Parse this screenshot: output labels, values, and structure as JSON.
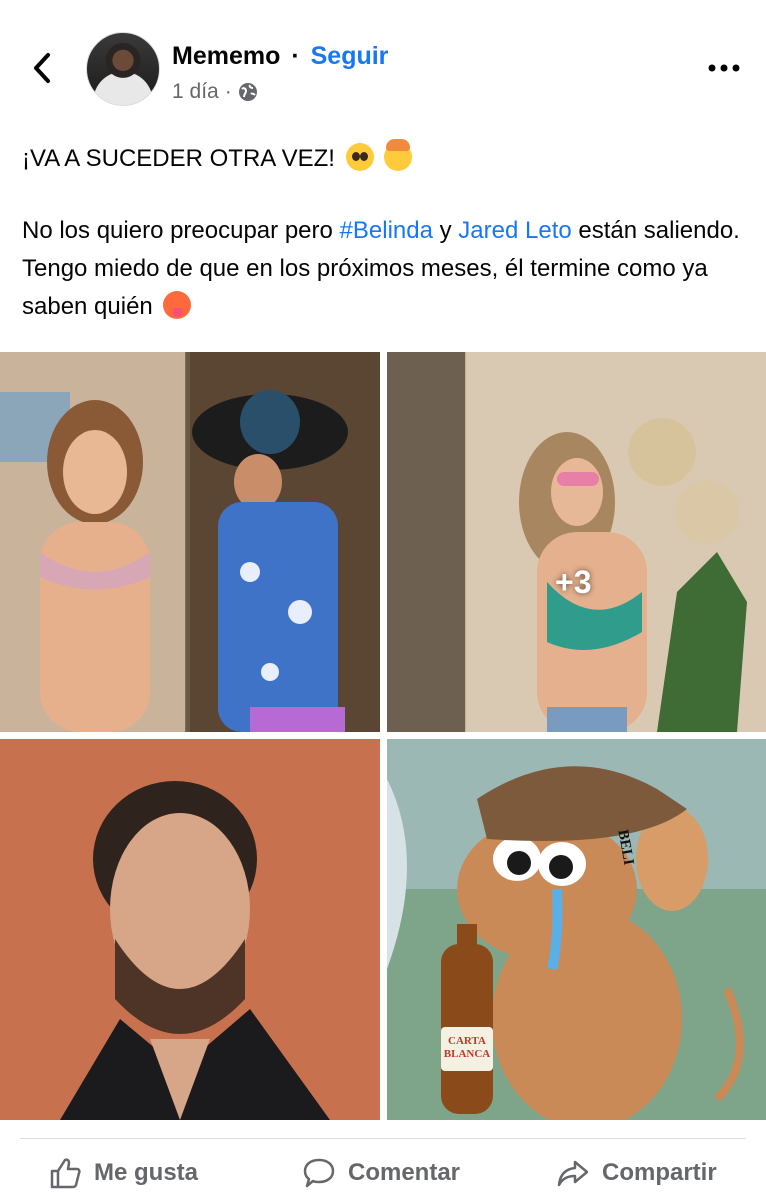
{
  "header": {
    "author": "Mememo",
    "separator": "·",
    "follow_label": "Seguir",
    "time_label": "1 día",
    "time_separator": "·",
    "privacy_icon": "globe-icon",
    "back_icon": "chevron-left-icon",
    "more_icon": "more-horizontal-icon"
  },
  "post": {
    "headline": "¡VA A SUCEDER OTRA VEZ!",
    "body_1": "No los quiero preocupar pero",
    "hashtag": "#Belinda",
    "body_2": "y",
    "mention": "Jared Leto",
    "body_3": "están saliendo. Tengo miedo de que en los próximos meses, él termine como ya saben quién"
  },
  "photos": {
    "more_count": "+3",
    "beer_label": "CARTA BLANCA",
    "hat_text": "BELI"
  },
  "actions": {
    "like_label": "Me gusta",
    "comment_label": "Comentar",
    "share_label": "Compartir"
  },
  "colors": {
    "link": "#1877f2",
    "secondary_text": "#65676b",
    "divider": "#dadde1"
  }
}
